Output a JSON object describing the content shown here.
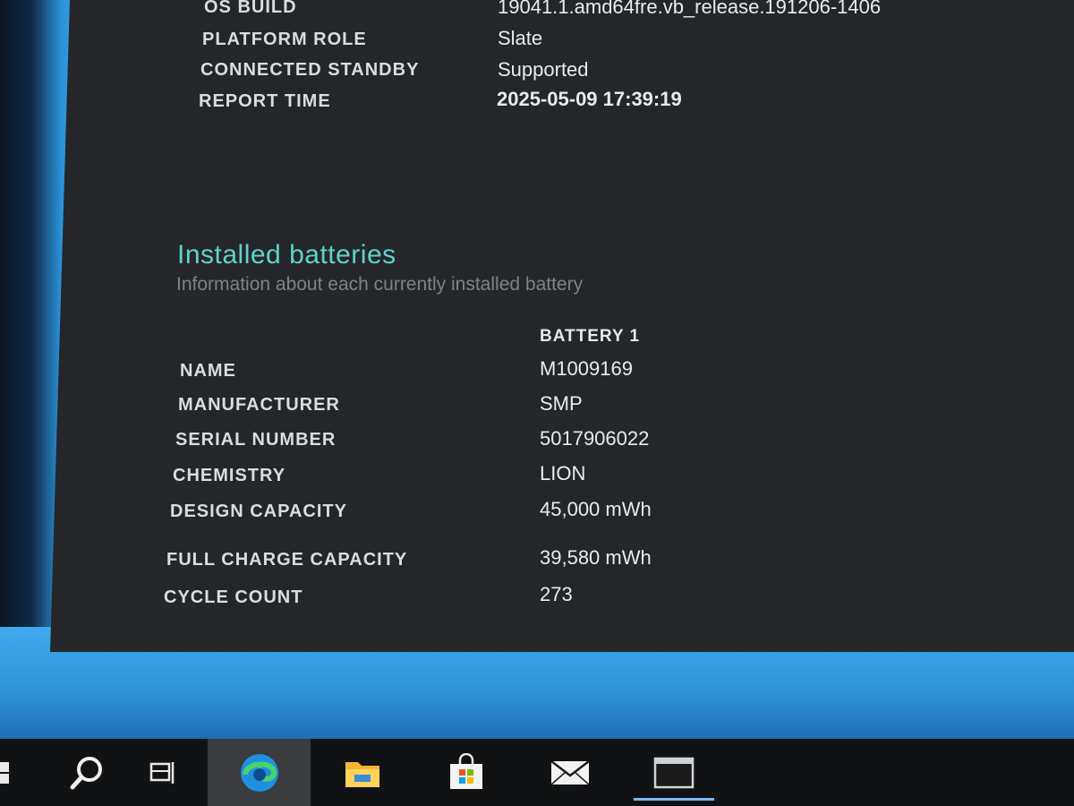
{
  "system_info": [
    {
      "label": "OS BUILD",
      "value": "19041.1.amd64fre.vb_release.191206-1406"
    },
    {
      "label": "PLATFORM ROLE",
      "value": "Slate"
    },
    {
      "label": "CONNECTED STANDBY",
      "value": "Supported"
    },
    {
      "label": "REPORT TIME",
      "value": "2025-05-09  17:39:19"
    }
  ],
  "batteries": {
    "title": "Installed batteries",
    "subtitle": "Information about each currently installed battery",
    "column_header": "BATTERY 1",
    "rows": [
      {
        "label": "NAME",
        "value": "M1009169"
      },
      {
        "label": "MANUFACTURER",
        "value": "SMP"
      },
      {
        "label": "SERIAL NUMBER",
        "value": "5017906022"
      },
      {
        "label": "CHEMISTRY",
        "value": "LION"
      },
      {
        "label": "DESIGN CAPACITY",
        "value": "45,000 mWh"
      },
      {
        "label": "FULL CHARGE CAPACITY",
        "value": "39,580 mWh"
      },
      {
        "label": "CYCLE COUNT",
        "value": "273"
      }
    ]
  },
  "taskbar": {
    "items": [
      {
        "icon": "windows-start-icon"
      },
      {
        "icon": "search-icon"
      },
      {
        "icon": "task-view-icon"
      },
      {
        "icon": "edge-browser-icon",
        "active": true
      },
      {
        "icon": "file-explorer-icon"
      },
      {
        "icon": "microsoft-store-icon"
      },
      {
        "icon": "mail-icon"
      },
      {
        "icon": "terminal-window-icon",
        "open": true
      }
    ]
  },
  "colors": {
    "accent_title": "#5fd3c8",
    "report_bg": "#252629",
    "desktop_blue": "#2d93d8",
    "taskbar_bg": "#111214"
  }
}
